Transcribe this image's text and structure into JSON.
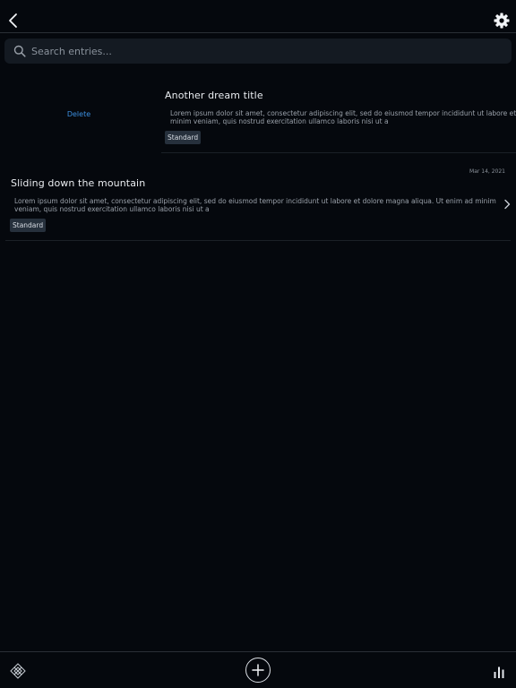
{
  "search": {
    "placeholder": "Search entries..."
  },
  "swipe_action": {
    "delete_label": "Delete"
  },
  "entries": [
    {
      "title": "Another dream title",
      "body_line1": "Lorem ipsum dolor sit amet, consectetur adipiscing elit, sed do eiusmod tempor incididunt ut labore et dolore",
      "body_line2": "minim veniam, quis nostrud exercitation ullamco laboris nisi ut a",
      "tag": "Standard"
    },
    {
      "title": "Sliding down the mountain",
      "date": "Mar 14, 2021",
      "body": "Lorem ipsum dolor sit amet, consectetur adipiscing elit, sed do eiusmod tempor incididunt ut labore et dolore magna aliqua. Ut enim ad minim veniam, quis nostrud exercitation ullamco laboris nisi ut a",
      "tag": "Standard"
    }
  ],
  "icons": {
    "back": "chevron-left-icon",
    "settings": "gear-icon",
    "search": "search-icon",
    "row_chevron": "chevron-right-icon",
    "dream": "dreamcatcher-icon",
    "add": "plus-icon",
    "stats": "bar-chart-icon"
  },
  "colors": {
    "background": "#05080d",
    "search_field": "#141a22",
    "tag_background": "#26303c",
    "delete_accent": "#3b8fe0",
    "text_primary": "#e9ecf0",
    "text_secondary": "#9aa1aa"
  }
}
